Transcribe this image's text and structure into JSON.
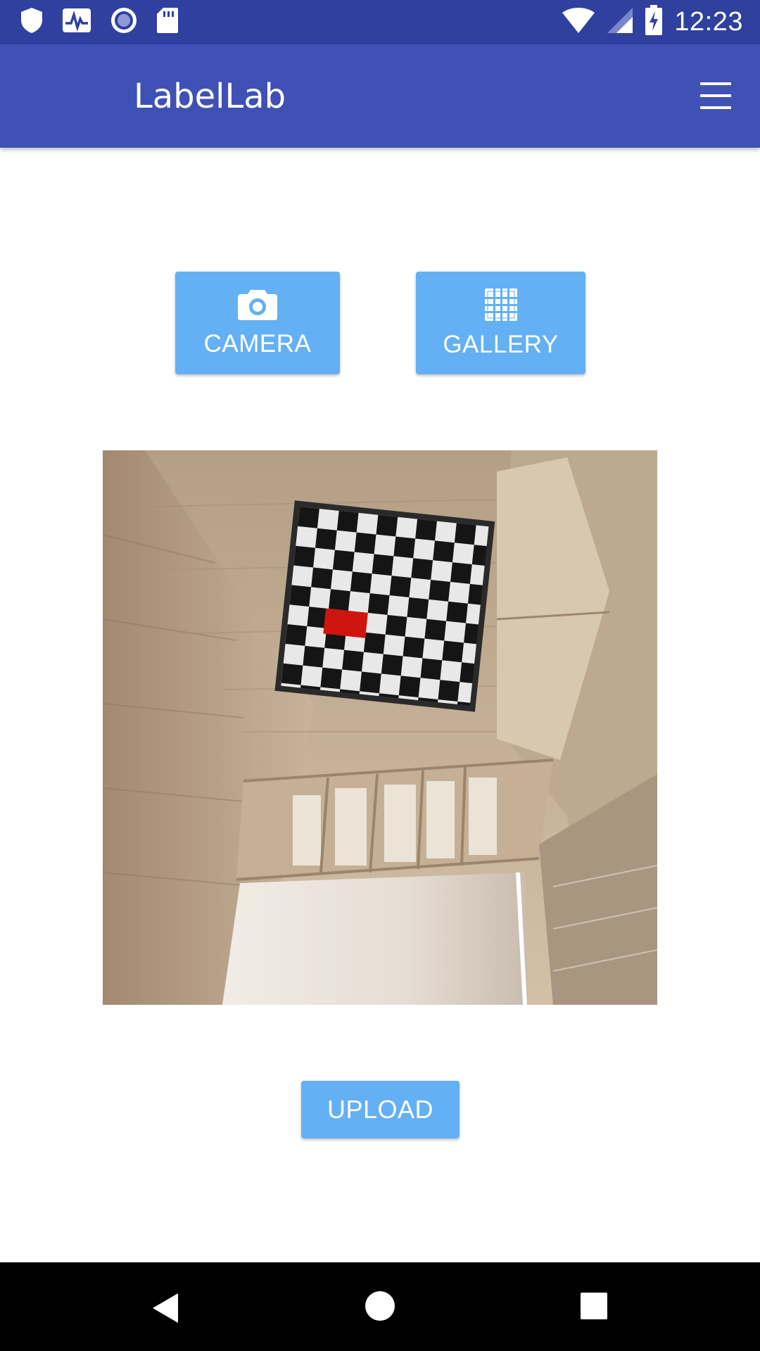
{
  "status_bar": {
    "time": "12:23",
    "left_icons": [
      "shield-icon",
      "activity-icon",
      "record-icon",
      "sd-card-icon"
    ],
    "right_icons": [
      "wifi-icon",
      "signal-icon",
      "battery-charging-icon"
    ]
  },
  "app_bar": {
    "title": "LabelLab",
    "menu_icon": "hamburger-menu-icon"
  },
  "actions": {
    "camera_label": "CAMERA",
    "camera_icon": "camera-icon",
    "gallery_label": "GALLERY",
    "gallery_icon": "grid-icon"
  },
  "preview": {
    "content": "room-photo-with-checkerboard"
  },
  "upload": {
    "label": "UPLOAD"
  },
  "nav_bar": {
    "items": [
      "back-icon",
      "home-icon",
      "recents-icon"
    ]
  },
  "colors": {
    "status_bar": "#30409f",
    "app_bar": "#3f51b5",
    "button": "#64b0f4",
    "nav_bar": "#000000"
  }
}
